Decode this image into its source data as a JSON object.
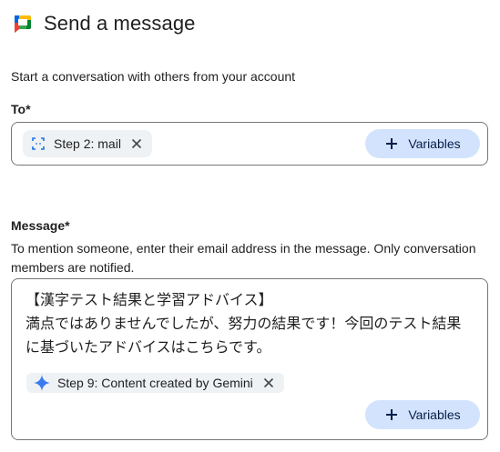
{
  "header": {
    "title": "Send a message",
    "logo_icon": "google-chat-logo-icon"
  },
  "subtitle": "Start a conversation with others from your account",
  "to_field": {
    "label": "To*",
    "chip": {
      "label": "Step 2: mail",
      "icon": "variable-brackets-icon"
    },
    "variables_button": "Variables"
  },
  "message_field": {
    "label": "Message*",
    "helper": "To mention someone, enter their email address in the message. Only conversation members are notified.",
    "text_lines": [
      "【漢字テスト結果と学習アドバイス】",
      "満点ではありませんでしたが、努力の結果です！今回のテスト結果",
      "に基づいたアドバイスはこちらです。"
    ],
    "chip": {
      "label": "Step 9: Content created by Gemini",
      "icon": "gemini-sparkle-icon"
    },
    "variables_button": "Variables"
  },
  "colors": {
    "chip_bg": "#eff2f5",
    "button_bg": "#d3e3fd",
    "button_text": "#041e49",
    "accent_blue": "#1a73e8"
  }
}
